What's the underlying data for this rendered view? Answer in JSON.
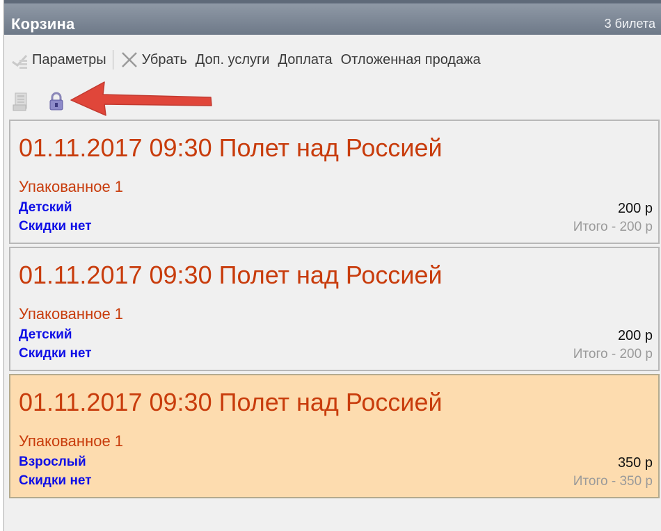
{
  "header": {
    "title": "Корзина",
    "count": "3 билета"
  },
  "toolbar": {
    "params": "Параметры",
    "remove": "Убрать",
    "services": "Доп. услуги",
    "surcharge": "Доплата",
    "deferred": "Отложенная продажа"
  },
  "colors": {
    "title_bar": "#7d8796",
    "event_text": "#c83c0c",
    "category_text": "#0e0ee6",
    "selected_bg": "#fddcaf",
    "arrow": "#e0463a"
  },
  "tickets": [
    {
      "event": "01.11.2017 09:30 Полет над Россией",
      "package": "Упакованное 1",
      "category": "Детский",
      "price": "200 р",
      "discount": "Скидки нет",
      "total": "Итого - 200 р",
      "selected": false
    },
    {
      "event": "01.11.2017 09:30 Полет над Россией",
      "package": "Упакованное 1",
      "category": "Детский",
      "price": "200 р",
      "discount": "Скидки нет",
      "total": "Итого - 200 р",
      "selected": false
    },
    {
      "event": "01.11.2017 09:30 Полет над Россией",
      "package": "Упакованное 1",
      "category": "Взрослый",
      "price": "350 р",
      "discount": "Скидки нет",
      "total": "Итого - 350 р",
      "selected": true
    }
  ]
}
